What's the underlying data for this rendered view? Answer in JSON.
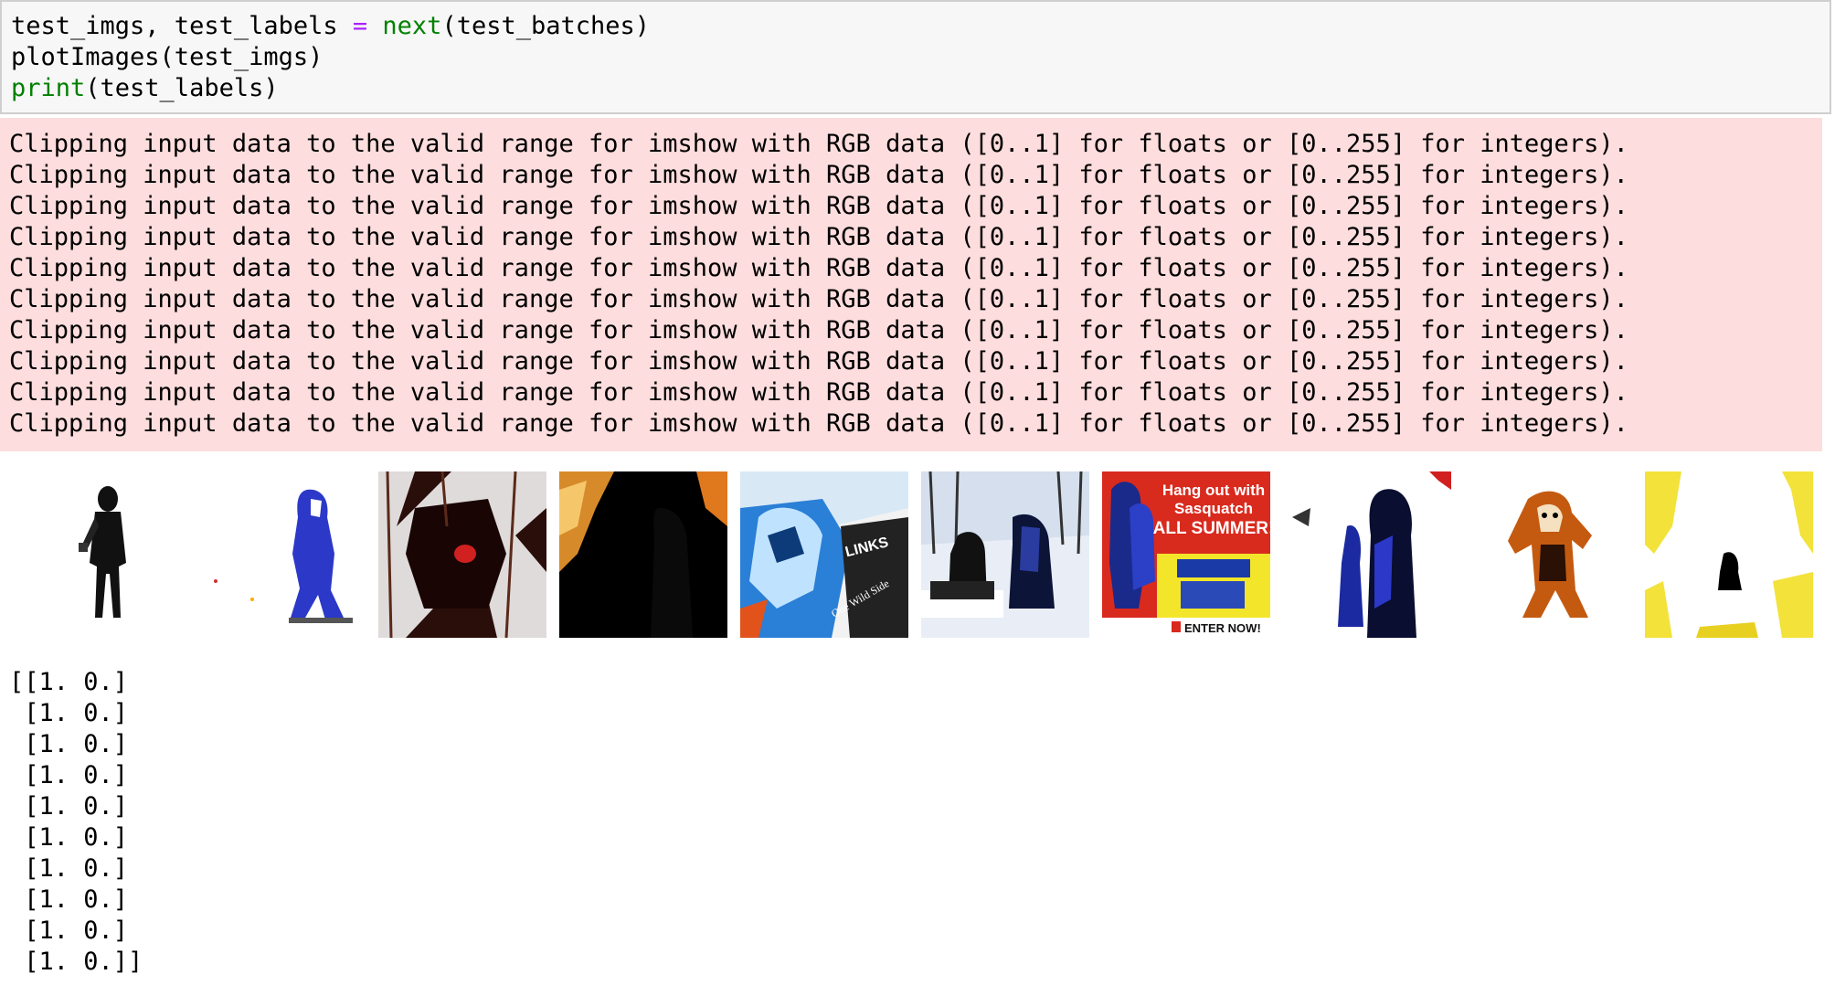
{
  "code_cell": {
    "lines": [
      {
        "a": "test_imgs, test_labels ",
        "op": "=",
        "b": " ",
        "fn": "next",
        "c": "(test_batches)"
      },
      {
        "a": "plotImages(test_imgs)"
      },
      {
        "fn": "print",
        "c": "(test_labels)"
      }
    ]
  },
  "stderr": {
    "lines": [
      "Clipping input data to the valid range for imshow with RGB data ([0..1] for floats or [0..255] for integers).",
      "Clipping input data to the valid range for imshow with RGB data ([0..1] for floats or [0..255] for integers).",
      "Clipping input data to the valid range for imshow with RGB data ([0..1] for floats or [0..255] for integers).",
      "Clipping input data to the valid range for imshow with RGB data ([0..1] for floats or [0..255] for integers).",
      "Clipping input data to the valid range for imshow with RGB data ([0..1] for floats or [0..255] for integers).",
      "Clipping input data to the valid range for imshow with RGB data ([0..1] for floats or [0..255] for integers).",
      "Clipping input data to the valid range for imshow with RGB data ([0..1] for floats or [0..255] for integers).",
      "Clipping input data to the valid range for imshow with RGB data ([0..1] for floats or [0..255] for integers).",
      "Clipping input data to the valid range for imshow with RGB data ([0..1] for floats or [0..255] for integers).",
      "Clipping input data to the valid range for imshow with RGB data ([0..1] for floats or [0..255] for integers)."
    ]
  },
  "image_strip": {
    "thumb7_text": {
      "line1": "Hang out with",
      "line2": "Sasquatch",
      "line3": "ALL SUMMER!",
      "cta": "ENTER NOW!"
    },
    "thumb5_text": "LINKS",
    "thumb5_text2": "One Wild Side"
  },
  "labels": {
    "lines": [
      "[[1. 0.]",
      " [1. 0.]",
      " [1. 0.]",
      " [1. 0.]",
      " [1. 0.]",
      " [1. 0.]",
      " [1. 0.]",
      " [1. 0.]",
      " [1. 0.]",
      " [1. 0.]]"
    ]
  },
  "colors": {
    "code_bg": "#f7f7f7",
    "stderr_bg": "#fddddd",
    "keyword_green": "#008000",
    "operator_purple": "#aa22ff"
  }
}
